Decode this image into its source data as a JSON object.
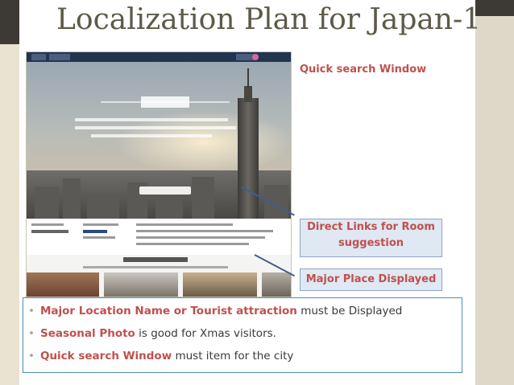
{
  "slide": {
    "title": "Localization Plan for Japan-1"
  },
  "callouts": {
    "quick_search": "Quick search Window",
    "direct_links_line1": "Direct Links for Room",
    "direct_links_line2": "suggestion",
    "major_place": "Major Place Displayed"
  },
  "bullets": [
    {
      "emphasis": "Major Location Name or Tourist attraction",
      "rest": " must be Displayed"
    },
    {
      "emphasis": "Seasonal Photo",
      "rest": " is good for Xmas visitors."
    },
    {
      "emphasis": "Quick search Window",
      "rest": " must item for the city"
    }
  ],
  "colors": {
    "accent_red": "#c0504d",
    "callout_fill": "#dfe8f3",
    "callout_border": "#8ea6c4",
    "title_color": "#5e5a49"
  }
}
